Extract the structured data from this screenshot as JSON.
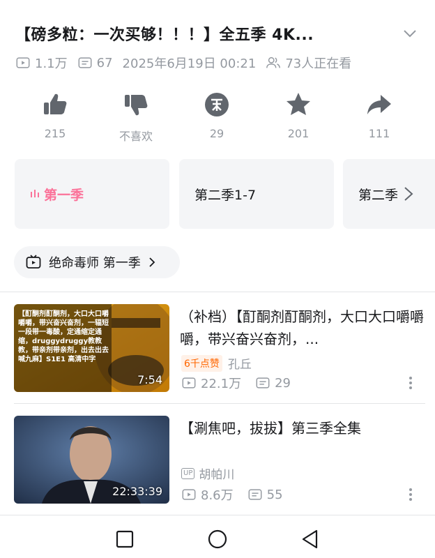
{
  "video": {
    "title": "【磅多粒：一次买够！！！】全五季 4K...",
    "views": "1.1万",
    "danmaku": "67",
    "date": "2025年6月19日 00:21",
    "watching": "73人正在看"
  },
  "actions": {
    "like": "215",
    "dislike": "不喜欢",
    "coin": "29",
    "favorite": "201",
    "share": "111"
  },
  "seasons": [
    {
      "label": "第一季",
      "active": true
    },
    {
      "label": "第二季1-7",
      "active": false
    },
    {
      "label": "第二季",
      "active": false
    }
  ],
  "collection": {
    "label": "绝命毒师 第一季"
  },
  "recommendations": [
    {
      "title": "（补档）【酊酮剂酊酮剂，大口大口嚼嚼嚼，带兴奋兴奋剂，...",
      "badge": "6千点赞",
      "author": "孔丘",
      "views": "22.1万",
      "danmaku": "29",
      "duration": "7:54",
      "thumb_text": "【酊酮剂酊酮剂，大口大口嚼嚼嚼，带兴奋兴奋剂，一辐短一段带一毒酸，定通缩定通缩，druggydruggy教教教，带亲剂带亲剂，出去出去喊九麻】S1E1 高清中字"
    },
    {
      "title": "【涮焦吧，拔拔】第三季全集",
      "up_tag": "UP",
      "author": "胡帕川",
      "views": "8.6万",
      "danmaku": "55",
      "duration": "22:33:39"
    }
  ],
  "colors": {
    "accent": "#fb7299",
    "muted": "#9499a0",
    "badge": "#ff6600"
  }
}
